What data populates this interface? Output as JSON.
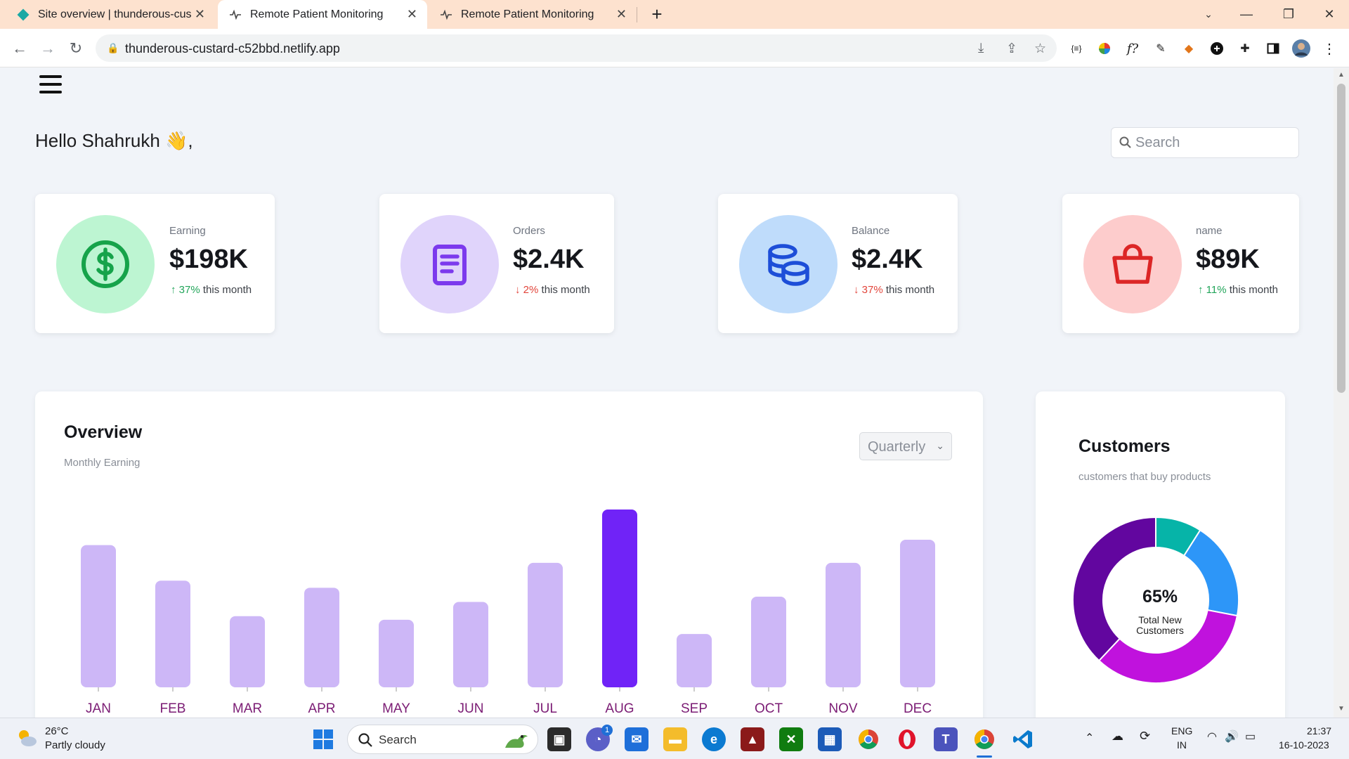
{
  "browser": {
    "tabs": [
      {
        "title": "Site overview | thunderous-custa",
        "active": false
      },
      {
        "title": "Remote Patient Monitoring",
        "active": true
      },
      {
        "title": "Remote Patient Monitoring",
        "active": false
      }
    ],
    "new_tab": "+",
    "url": "thunderous-custard-c52bbd.netlify.app"
  },
  "header": {
    "greeting": "Hello Shahrukh 👋,",
    "search_placeholder": "Search"
  },
  "stats": [
    {
      "label": "Earning",
      "value": "$198K",
      "trend_arrow": "↑",
      "trend_pct": "37%",
      "trend_dir": "up",
      "trend_text": "this month",
      "icon": "dollar-icon",
      "circle_color": "#bdf5d2",
      "icon_color": "#16a34a"
    },
    {
      "label": "Orders",
      "value": "$2.4K",
      "trend_arrow": "↓",
      "trend_pct": "2%",
      "trend_dir": "down",
      "trend_text": "this month",
      "icon": "document-icon",
      "circle_color": "#e0d4fb",
      "icon_color": "#7c3aed"
    },
    {
      "label": "Balance",
      "value": "$2.4K",
      "trend_arrow": "↓",
      "trend_pct": "37%",
      "trend_dir": "down",
      "trend_text": "this month",
      "icon": "coins-icon",
      "circle_color": "#bfdcfb",
      "icon_color": "#1d4ed8"
    },
    {
      "label": "name",
      "value": "$89K",
      "trend_arrow": "↑",
      "trend_pct": "11%",
      "trend_dir": "up",
      "trend_text": "this month",
      "icon": "shopping-bag-icon",
      "circle_color": "#fdcccc",
      "icon_color": "#dc2626"
    }
  ],
  "overview": {
    "title": "Overview",
    "subtitle": "Monthly Earning",
    "period": "Quarterly"
  },
  "chart_data": {
    "type": "bar",
    "categories": [
      "JAN",
      "FEB",
      "MAR",
      "APR",
      "MAY",
      "JUN",
      "JUL",
      "AUG",
      "SEP",
      "OCT",
      "NOV",
      "DEC"
    ],
    "values": [
      80,
      60,
      40,
      56,
      38,
      48,
      70,
      100,
      30,
      51,
      70,
      83
    ],
    "highlight_index": 7,
    "bar_color": "#cdb7f7",
    "highlight_color": "#7023f7",
    "label_color": "#7b1c74"
  },
  "customers": {
    "title": "Customers",
    "subtitle": "customers that buy products",
    "center_value": "65%",
    "center_label_line1": "Total New",
    "center_label_line2": "Customers",
    "chart_data": {
      "type": "pie",
      "slices": [
        {
          "value": 9,
          "color": "#06b4a8"
        },
        {
          "value": 19,
          "color": "#2d96f8"
        },
        {
          "value": 34,
          "color": "#c012dd"
        },
        {
          "value": 38,
          "color": "#62069f"
        }
      ]
    }
  },
  "taskbar": {
    "weather_temp": "26°C",
    "weather_desc": "Partly cloudy",
    "search_label": "Search",
    "lang_line1": "ENG",
    "lang_line2": "IN",
    "time": "21:37",
    "date": "16-10-2023",
    "badge": "1"
  }
}
